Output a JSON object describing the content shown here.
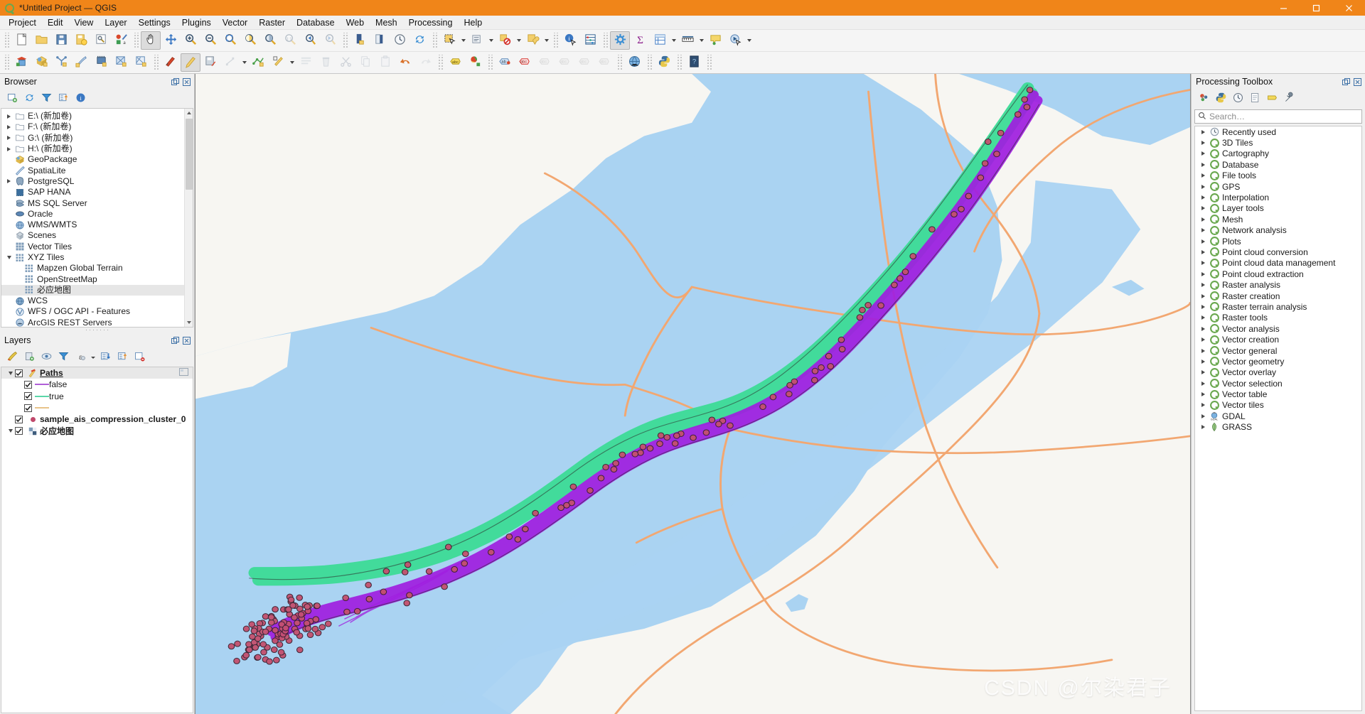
{
  "window": {
    "title": "*Untitled Project — QGIS",
    "logo_icon": "qgis-logo-icon",
    "minimize_label": "Minimize",
    "maximize_label": "Maximize",
    "close_label": "Close",
    "accent_color": "#f08519"
  },
  "menubar": {
    "items": [
      {
        "label": "Project"
      },
      {
        "label": "Edit"
      },
      {
        "label": "View"
      },
      {
        "label": "Layer"
      },
      {
        "label": "Settings"
      },
      {
        "label": "Plugins"
      },
      {
        "label": "Vector"
      },
      {
        "label": "Raster"
      },
      {
        "label": "Database"
      },
      {
        "label": "Web"
      },
      {
        "label": "Mesh"
      },
      {
        "label": "Processing"
      },
      {
        "label": "Help"
      }
    ]
  },
  "toolbar_row1": [
    {
      "icon": "new-project-icon",
      "name": "new-project-button"
    },
    {
      "icon": "open-project-icon",
      "name": "open-project-button"
    },
    {
      "icon": "save-project-icon",
      "name": "save-project-button"
    },
    {
      "icon": "save-project-as-icon",
      "name": "save-project-as-button"
    },
    {
      "icon": "project-properties-icon",
      "name": "project-properties-button"
    },
    {
      "icon": "style-manager-icon",
      "name": "style-manager-button"
    },
    {
      "icon": "pan-map-icon",
      "name": "pan-map-button",
      "active": true
    },
    {
      "icon": "pan-to-selection-icon",
      "name": "pan-to-selection-button"
    },
    {
      "icon": "zoom-in-icon",
      "name": "zoom-in-button"
    },
    {
      "icon": "zoom-out-icon",
      "name": "zoom-out-button"
    },
    {
      "icon": "zoom-full-icon",
      "name": "zoom-full-button"
    },
    {
      "icon": "zoom-to-selection-icon",
      "name": "zoom-to-selection-button"
    },
    {
      "icon": "zoom-to-layer-icon",
      "name": "zoom-to-layer-button"
    },
    {
      "icon": "zoom-native-icon",
      "name": "zoom-native-button",
      "dim": true
    },
    {
      "icon": "zoom-last-icon",
      "name": "zoom-last-button"
    },
    {
      "icon": "zoom-next-icon",
      "name": "zoom-next-button",
      "dim": true
    },
    {
      "icon": "new-map-view-icon",
      "name": "new-map-view-button"
    },
    {
      "icon": "new-3d-map-view-icon",
      "name": "new-3d-map-view-button"
    },
    {
      "icon": "temporal-controller-icon",
      "name": "temporal-controller-button"
    },
    {
      "icon": "refresh-icon",
      "name": "refresh-button"
    },
    {
      "icon": "select-features-icon",
      "name": "select-features-button"
    },
    {
      "icon": "select-by-value-icon",
      "name": "select-by-value-button"
    },
    {
      "icon": "deselect-features-icon",
      "name": "deselect-features-button"
    },
    {
      "icon": "select-by-location-icon",
      "name": "select-by-location-button"
    },
    {
      "icon": "identify-features-icon",
      "name": "identify-features-button"
    },
    {
      "icon": "statistical-summary-icon",
      "name": "statistical-summary-button"
    },
    {
      "icon": "processing-toolbox-icon",
      "name": "processing-toolbox-button",
      "active": true
    },
    {
      "icon": "field-calculator-icon",
      "name": "field-calculator-button"
    },
    {
      "icon": "open-attribute-table-icon",
      "name": "open-attribute-table-button"
    },
    {
      "icon": "measure-line-icon",
      "name": "measure-line-button"
    },
    {
      "icon": "map-tips-icon",
      "name": "map-tips-button"
    },
    {
      "icon": "run-feature-action-icon",
      "name": "run-feature-action-button"
    }
  ],
  "toolbar_row2": [
    {
      "icon": "add-vector-layer-icon",
      "name": "add-vector-layer-button"
    },
    {
      "icon": "add-raster-layer-icon",
      "name": "add-raster-layer-button"
    },
    {
      "icon": "add-mesh-layer-icon",
      "name": "add-mesh-layer-button"
    },
    {
      "icon": "add-delimited-text-layer-icon",
      "name": "add-delimited-text-layer-button"
    },
    {
      "icon": "add-postgis-layer-icon",
      "name": "add-postgis-layer-button"
    },
    {
      "icon": "add-spatialite-layer-icon",
      "name": "add-spatialite-layer-button"
    },
    {
      "icon": "add-wms-layer-icon",
      "name": "add-wms-layer-button"
    },
    {
      "icon": "current-edits-icon",
      "name": "current-edits-button"
    },
    {
      "icon": "toggle-editing-icon",
      "name": "toggle-editing-button",
      "active": true
    },
    {
      "icon": "save-layer-edits-icon",
      "name": "save-layer-edits-button"
    },
    {
      "icon": "add-feature-icon",
      "name": "add-feature-button",
      "dim": true
    },
    {
      "icon": "vertex-tool-icon",
      "name": "vertex-tool-button"
    },
    {
      "icon": "modify-attributes-icon",
      "name": "modify-attributes-button"
    },
    {
      "icon": "multi-edit-icon",
      "name": "multi-edit-button",
      "dim": true
    },
    {
      "icon": "delete-selected-icon",
      "name": "delete-selected-button",
      "dim": true
    },
    {
      "icon": "cut-features-icon",
      "name": "cut-features-button",
      "dim": true
    },
    {
      "icon": "copy-features-icon",
      "name": "copy-features-button",
      "dim": true
    },
    {
      "icon": "paste-features-icon",
      "name": "paste-features-button",
      "dim": true
    },
    {
      "icon": "undo-icon",
      "name": "undo-button"
    },
    {
      "icon": "redo-icon",
      "name": "redo-button",
      "dim": true
    },
    {
      "icon": "label-icon",
      "name": "label-button"
    },
    {
      "icon": "styling-icon",
      "name": "styling-button"
    },
    {
      "icon": "pin-labels-icon",
      "name": "pin-labels-button"
    },
    {
      "icon": "show-hide-labels-icon",
      "name": "show-hide-labels-button"
    },
    {
      "icon": "move-label-icon",
      "name": "move-label-button",
      "dim": true
    },
    {
      "icon": "rotate-label-icon",
      "name": "rotate-label-button",
      "dim": true
    },
    {
      "icon": "change-label-icon",
      "name": "change-label-button",
      "dim": true
    },
    {
      "icon": "change-label-properties-icon",
      "name": "change-label-properties-button",
      "dim": true
    },
    {
      "icon": "open-osm-icon",
      "name": "open-osm-button"
    },
    {
      "icon": "python-console-icon",
      "name": "python-console-button"
    },
    {
      "icon": "help-icon",
      "name": "help-button"
    }
  ],
  "browser": {
    "title": "Browser",
    "toolbar": [
      {
        "icon": "add-layer-icon",
        "name": "browser-add-selected-layers-button"
      },
      {
        "icon": "refresh-icon",
        "name": "browser-refresh-button"
      },
      {
        "icon": "filter-icon",
        "name": "browser-filter-button"
      },
      {
        "icon": "collapse-all-icon",
        "name": "browser-collapse-all-button"
      },
      {
        "icon": "info-icon",
        "name": "browser-properties-button"
      }
    ],
    "items": [
      {
        "label": "E:\\ (新加卷)",
        "icon": "folder-icon",
        "expandable": true,
        "indent": 0
      },
      {
        "label": "F:\\ (新加卷)",
        "icon": "folder-icon",
        "expandable": true,
        "indent": 0
      },
      {
        "label": "G:\\ (新加卷)",
        "icon": "folder-icon",
        "expandable": true,
        "indent": 0
      },
      {
        "label": "H:\\ (新加卷)",
        "icon": "folder-icon",
        "expandable": true,
        "indent": 0
      },
      {
        "label": "GeoPackage",
        "icon": "geopackage-icon",
        "expandable": false,
        "indent": 0
      },
      {
        "label": "SpatiaLite",
        "icon": "spatialite-icon",
        "expandable": false,
        "indent": 0
      },
      {
        "label": "PostgreSQL",
        "icon": "postgresql-icon",
        "expandable": true,
        "indent": 0
      },
      {
        "label": "SAP HANA",
        "icon": "sap-hana-icon",
        "expandable": false,
        "indent": 0
      },
      {
        "label": "MS SQL Server",
        "icon": "mssql-icon",
        "expandable": false,
        "indent": 0
      },
      {
        "label": "Oracle",
        "icon": "oracle-icon",
        "expandable": false,
        "indent": 0
      },
      {
        "label": "WMS/WMTS",
        "icon": "wms-icon",
        "expandable": false,
        "indent": 0
      },
      {
        "label": "Scenes",
        "icon": "scenes-icon",
        "expandable": false,
        "indent": 0
      },
      {
        "label": "Vector Tiles",
        "icon": "vector-tiles-icon",
        "expandable": false,
        "indent": 0
      },
      {
        "label": "XYZ Tiles",
        "icon": "xyz-tiles-icon",
        "expandable": true,
        "expanded": true,
        "indent": 0
      },
      {
        "label": "Mapzen Global Terrain",
        "icon": "xyz-tiles-icon",
        "expandable": false,
        "indent": 1
      },
      {
        "label": "OpenStreetMap",
        "icon": "xyz-tiles-icon",
        "expandable": false,
        "indent": 1
      },
      {
        "label": "必应地图",
        "icon": "xyz-tiles-icon",
        "expandable": false,
        "indent": 1,
        "selected": true
      },
      {
        "label": "WCS",
        "icon": "wcs-icon",
        "expandable": false,
        "indent": 0
      },
      {
        "label": "WFS / OGC API - Features",
        "icon": "wfs-icon",
        "expandable": false,
        "indent": 0
      },
      {
        "label": "ArcGIS REST Servers",
        "icon": "arcgis-icon",
        "expandable": false,
        "indent": 0
      }
    ]
  },
  "layers": {
    "title": "Layers",
    "toolbar": [
      {
        "icon": "open-layer-styling-panel-icon",
        "name": "layer-styling-panel-button"
      },
      {
        "icon": "add-group-icon",
        "name": "add-group-button"
      },
      {
        "icon": "manage-map-themes-icon",
        "name": "manage-map-themes-button"
      },
      {
        "icon": "filter-legend-icon",
        "name": "filter-legend-button"
      },
      {
        "icon": "filter-legend-expression-icon",
        "name": "filter-legend-expression-button"
      },
      {
        "icon": "expand-all-icon",
        "name": "expand-all-button"
      },
      {
        "icon": "collapse-all-icon",
        "name": "collapse-all-button"
      },
      {
        "icon": "remove-layer-icon",
        "name": "remove-layer-button"
      }
    ],
    "items": [
      {
        "label": "Paths",
        "type": "group-layer",
        "checked": true,
        "expanded": true,
        "icon": "edit-pencil-icon",
        "bold": true,
        "underline": true,
        "selected": true,
        "indent": 0
      },
      {
        "label": "false",
        "type": "legend-line",
        "checked": true,
        "color": "#b05fd8",
        "indent": 1
      },
      {
        "label": "true",
        "type": "legend-line",
        "checked": true,
        "color": "#5ad7a8",
        "indent": 1
      },
      {
        "label": "",
        "type": "legend-line",
        "checked": true,
        "color": "#e8c38a",
        "indent": 1
      },
      {
        "label": "sample_ais_compression_cluster_0",
        "type": "point-layer",
        "checked": true,
        "color": "#c0486b",
        "bold": true,
        "indent": 0
      },
      {
        "label": "必应地图",
        "type": "raster-layer",
        "checked": true,
        "expanded": true,
        "icon": "raster-checker-icon",
        "bold": true,
        "indent": 0
      }
    ]
  },
  "processing": {
    "title": "Processing Toolbox",
    "toolbar": [
      {
        "icon": "run-model-icon",
        "name": "processing-models-button"
      },
      {
        "icon": "python-scripts-icon",
        "name": "processing-scripts-button"
      },
      {
        "icon": "history-icon",
        "name": "processing-history-button"
      },
      {
        "icon": "results-viewer-icon",
        "name": "processing-results-button"
      },
      {
        "icon": "graphical-modeler-icon",
        "name": "processing-graphical-modeler-button"
      },
      {
        "icon": "options-wrench-icon",
        "name": "processing-options-button"
      }
    ],
    "search": {
      "placeholder": "Search…",
      "value": "",
      "icon": "search-icon"
    },
    "items": [
      {
        "label": "Recently used",
        "icon": "clock-icon"
      },
      {
        "label": "3D Tiles",
        "icon": "qgis-provider-icon"
      },
      {
        "label": "Cartography",
        "icon": "qgis-provider-icon"
      },
      {
        "label": "Database",
        "icon": "qgis-provider-icon"
      },
      {
        "label": "File tools",
        "icon": "qgis-provider-icon"
      },
      {
        "label": "GPS",
        "icon": "qgis-provider-icon"
      },
      {
        "label": "Interpolation",
        "icon": "qgis-provider-icon"
      },
      {
        "label": "Layer tools",
        "icon": "qgis-provider-icon"
      },
      {
        "label": "Mesh",
        "icon": "qgis-provider-icon"
      },
      {
        "label": "Network analysis",
        "icon": "qgis-provider-icon"
      },
      {
        "label": "Plots",
        "icon": "qgis-provider-icon"
      },
      {
        "label": "Point cloud conversion",
        "icon": "qgis-provider-icon"
      },
      {
        "label": "Point cloud data management",
        "icon": "qgis-provider-icon"
      },
      {
        "label": "Point cloud extraction",
        "icon": "qgis-provider-icon"
      },
      {
        "label": "Raster analysis",
        "icon": "qgis-provider-icon"
      },
      {
        "label": "Raster creation",
        "icon": "qgis-provider-icon"
      },
      {
        "label": "Raster terrain analysis",
        "icon": "qgis-provider-icon"
      },
      {
        "label": "Raster tools",
        "icon": "qgis-provider-icon"
      },
      {
        "label": "Vector analysis",
        "icon": "qgis-provider-icon"
      },
      {
        "label": "Vector creation",
        "icon": "qgis-provider-icon"
      },
      {
        "label": "Vector general",
        "icon": "qgis-provider-icon"
      },
      {
        "label": "Vector geometry",
        "icon": "qgis-provider-icon"
      },
      {
        "label": "Vector overlay",
        "icon": "qgis-provider-icon"
      },
      {
        "label": "Vector selection",
        "icon": "qgis-provider-icon"
      },
      {
        "label": "Vector table",
        "icon": "qgis-provider-icon"
      },
      {
        "label": "Vector tiles",
        "icon": "qgis-provider-icon"
      },
      {
        "label": "GDAL",
        "icon": "gdal-icon"
      },
      {
        "label": "GRASS",
        "icon": "grass-icon"
      }
    ]
  },
  "map": {
    "watermark": "CSDN @尔染君子",
    "colors": {
      "water": "#aad3f2",
      "land": "#f7f6f2",
      "road": "#f2a771",
      "track_true": "#3ddc97",
      "track_false": "#a01ee0",
      "point": "#c4506e"
    }
  }
}
